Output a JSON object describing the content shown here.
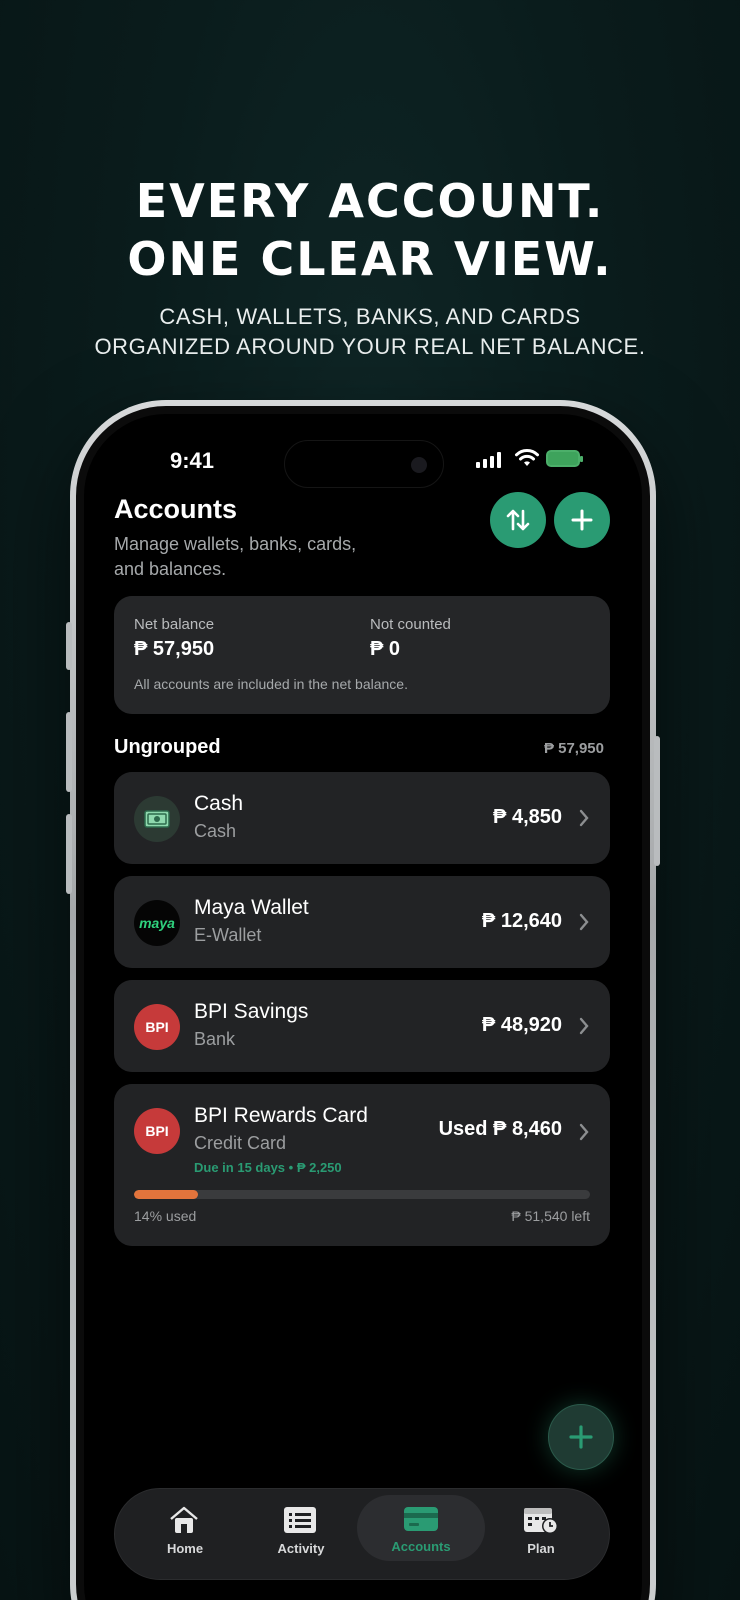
{
  "promo": {
    "headline_line1": "EVERY ACCOUNT.",
    "headline_line2": "ONE CLEAR VIEW.",
    "subhead_line1": "CASH, WALLETS, BANKS, AND CARDS",
    "subhead_line2": "ORGANIZED AROUND YOUR REAL NET BALANCE."
  },
  "status_bar": {
    "time": "9:41"
  },
  "header": {
    "title": "Accounts",
    "subtitle": "Manage wallets, banks, cards, and balances.",
    "transfer_icon": "swap-vertical-icon",
    "add_icon": "plus-icon"
  },
  "summary": {
    "net_label": "Net balance",
    "net_value": "₱ 57,950",
    "not_counted_label": "Not counted",
    "not_counted_value": "₱ 0",
    "note": "All accounts are included in the net balance."
  },
  "group": {
    "title": "Ungrouped",
    "total": "₱ 57,950"
  },
  "accounts": [
    {
      "name": "Cash",
      "type": "Cash",
      "amount": "₱ 4,850",
      "icon": "banknote-icon"
    },
    {
      "name": "Maya Wallet",
      "type": "E-Wallet",
      "amount": "₱ 12,640",
      "icon_text": "maya"
    },
    {
      "name": "BPI Savings",
      "type": "Bank",
      "amount": "₱ 48,920",
      "icon_text": "BPI"
    },
    {
      "name": "BPI Rewards Card",
      "type": "Credit Card",
      "amount": "Used ₱ 8,460",
      "icon_text": "BPI",
      "due": "Due in 15 days • ₱ 2,250",
      "used_pct_label": "14% used",
      "used_fraction": 0.14,
      "left": "₱ 51,540 left"
    }
  ],
  "tabs": [
    {
      "label": "Home",
      "icon": "home-icon"
    },
    {
      "label": "Activity",
      "icon": "list-icon"
    },
    {
      "label": "Accounts",
      "icon": "card-icon",
      "active": true
    },
    {
      "label": "Plan",
      "icon": "calendar-clock-icon"
    }
  ],
  "colors": {
    "accent": "#2a9b73",
    "progress": "#e2743c",
    "card_bg": "#222325"
  }
}
